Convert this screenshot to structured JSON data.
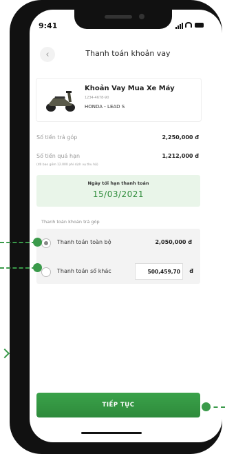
{
  "status_bar": {
    "time": "9:41"
  },
  "header": {
    "title": "Thanh toán khoản vay",
    "back_icon": "chevron-left-icon"
  },
  "loan": {
    "title": "Khoản Vay Mua Xe Máy",
    "code": "1234-4678-90",
    "model": "HONDA - LEAD S"
  },
  "summary": {
    "installment_label": "Số tiền trả góp",
    "installment_value": "2,250,000 đ",
    "overdue_label": "Số tiền quá hạn",
    "overdue_value": "1,212,000 đ",
    "overdue_note": "(đã bao gồm 12.000 phí dịch vụ thu hộ)"
  },
  "due": {
    "label": "Ngày tới hạn thanh toán",
    "date": "15/03/2021"
  },
  "payment": {
    "section_label": "Thanh toán khoản trả góp",
    "option_full_label": "Thanh toán toàn bộ",
    "option_full_amount": "2,050,000 đ",
    "option_other_label": "Thanh toán số khác",
    "option_other_value": "500,459,70",
    "currency": "đ",
    "selected": "full"
  },
  "cta": {
    "label": "TIẾP TỤC"
  },
  "colors": {
    "accent": "#2e8b3a",
    "due_bg": "#e9f5e9"
  }
}
